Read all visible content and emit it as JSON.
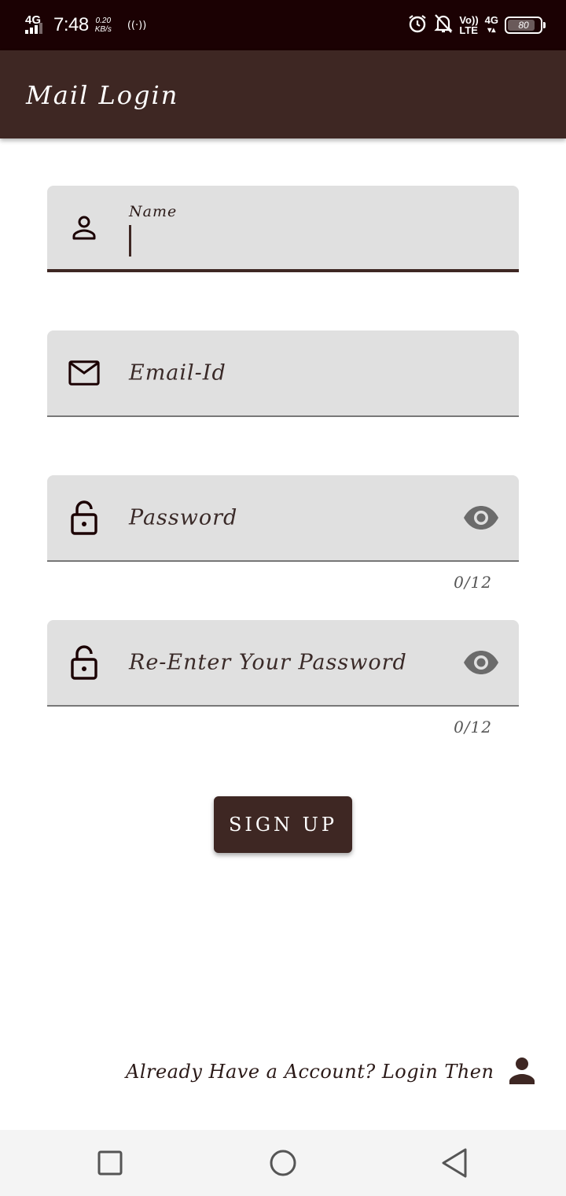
{
  "status_bar": {
    "network": "4G",
    "time": "7:48",
    "speed_value": "0.20",
    "speed_unit": "KB/s",
    "volte_top": "Vo))",
    "volte_bottom": "LTE",
    "data_type": "4G",
    "battery_level": "80"
  },
  "app_bar": {
    "title": "Mail Login"
  },
  "form": {
    "name_field": {
      "label": "Name",
      "value": "",
      "icon": "person-outline-icon"
    },
    "email_field": {
      "placeholder": "Email-Id",
      "icon": "mail-icon"
    },
    "password_field": {
      "placeholder": "Password",
      "icon": "lock-open-icon",
      "counter": "0/12"
    },
    "reenter_password_field": {
      "placeholder": "Re-Enter Your Password",
      "icon": "lock-open-icon",
      "counter": "0/12"
    },
    "signup_label": "SIGN UP"
  },
  "footer": {
    "login_prompt": "Already Have a Account?  Login Then",
    "icon": "person-icon"
  },
  "colors": {
    "primary": "#3e2723",
    "status_bar": "#1b0103",
    "field_bg": "#e0e0e0"
  }
}
